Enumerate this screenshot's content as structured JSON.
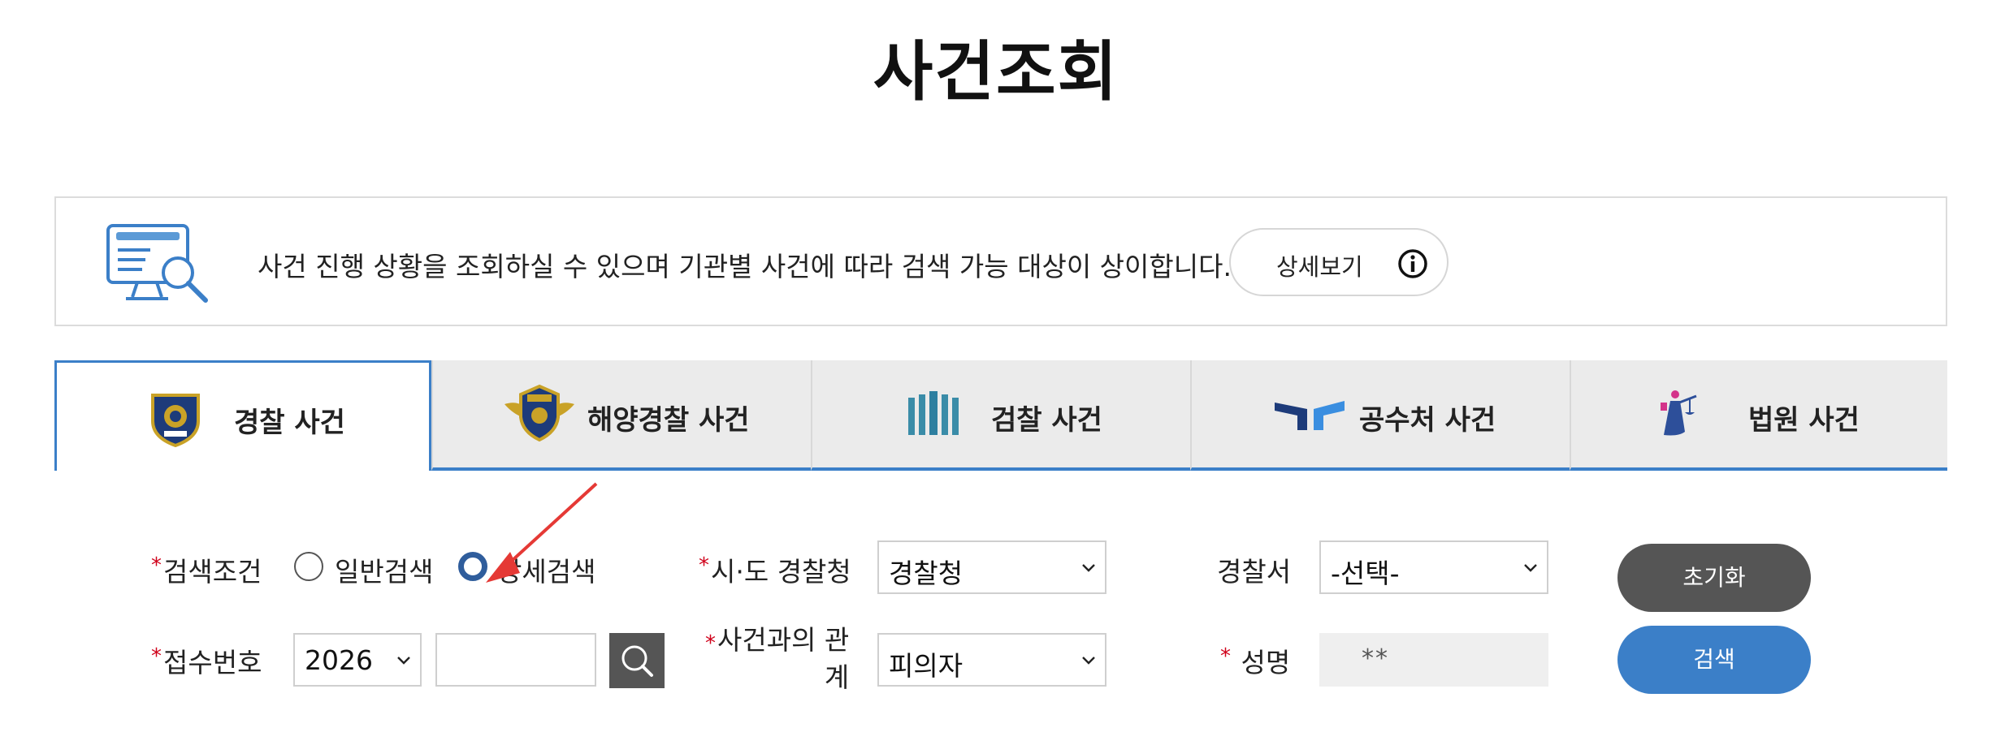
{
  "title": "사건조회",
  "info": {
    "text": "사건 진행 상황을 조회하실 수 있으며 기관별 사건에 따라 검색 가능 대상이 상이합니다.",
    "detail_button": "상세보기",
    "icons": {
      "banner": "monitor-search-icon",
      "detail": "info-circle-icon"
    }
  },
  "tabs": [
    {
      "label": "경찰 사건",
      "icon": "police-emblem-icon",
      "active": true
    },
    {
      "label": "해양경찰 사건",
      "icon": "coast-guard-emblem-icon",
      "active": false
    },
    {
      "label": "검찰 사건",
      "icon": "prosecution-logo-icon",
      "active": false
    },
    {
      "label": "공수처 사건",
      "icon": "cio-logo-icon",
      "active": false
    },
    {
      "label": "법원 사건",
      "icon": "court-justice-icon",
      "active": false
    }
  ],
  "form": {
    "search_condition": {
      "label": "검색조건",
      "options": [
        "일반검색",
        "상세검색"
      ],
      "selected": "상세검색"
    },
    "sido_police": {
      "label": "시·도 경찰청",
      "value": "경찰청"
    },
    "police_station": {
      "label": "경찰서",
      "value": "-선택-"
    },
    "receipt_no": {
      "label": "접수번호",
      "year": "2026",
      "number": ""
    },
    "relation": {
      "label_line1": "사건과의 관",
      "label_line2": "계",
      "value": "피의자"
    },
    "name": {
      "label": "성명",
      "value": "**"
    },
    "required_mark": "*"
  },
  "buttons": {
    "reset": "초기화",
    "search": "검색"
  },
  "colors": {
    "accent": "#3b7fc8",
    "required": "#d0021b",
    "dark_button": "#555555",
    "annotation_arrow": "#e53935"
  }
}
